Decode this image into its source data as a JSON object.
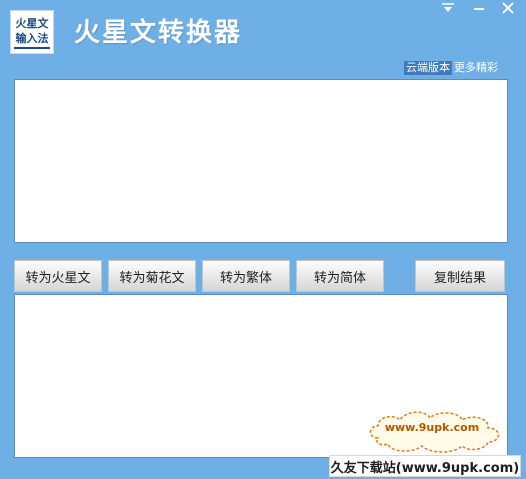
{
  "app": {
    "logo_line1": "火星文",
    "logo_line2": "输入法",
    "title": "火星文转换器"
  },
  "header_links": {
    "cloud_version": "云端版本",
    "more": "更多精彩"
  },
  "input_area": {
    "value": ""
  },
  "buttons": {
    "to_martian": "转为火星文",
    "to_chrysanthemum": "转为菊花文",
    "to_traditional": "转为繁体",
    "to_simplified": "转为简体",
    "copy_result": "复制结果"
  },
  "output_area": {
    "value": ""
  },
  "watermark": {
    "cloud_url": "www.9upk.com",
    "bottom_text": "久友下载站(www.9upk.com)"
  },
  "icons": [
    "menu-icon",
    "minimize-icon",
    "close-icon"
  ]
}
